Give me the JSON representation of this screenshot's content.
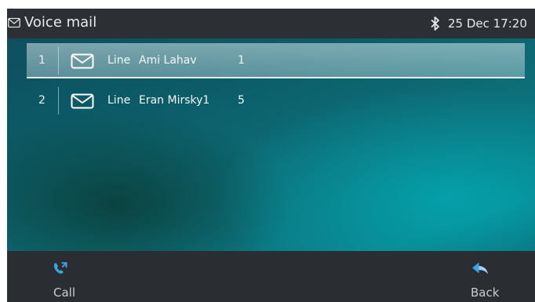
{
  "header": {
    "title": "Voice mail",
    "datetime": "25 Dec 17:20",
    "title_icon": "envelope-icon",
    "status_icon": "bluetooth-icon"
  },
  "voicemail_list": {
    "selected_index": 0,
    "items": [
      {
        "index": "1",
        "icon": "envelope-icon",
        "line_label": "Line",
        "name": "Ami Lahav",
        "count": "1"
      },
      {
        "index": "2",
        "icon": "envelope-icon",
        "line_label": "Line",
        "name": "Eran Mirsky1",
        "count": "5"
      }
    ]
  },
  "softkeys": {
    "left": {
      "label": "Call",
      "icon": "call-handset-icon"
    },
    "right": {
      "label": "Back",
      "icon": "back-arrow-icon"
    }
  },
  "colors": {
    "titlebar": "#2c2f33",
    "softbar": "#2a2d31",
    "accent_blue": "#3aa6e0",
    "text": "#e8eaec"
  }
}
